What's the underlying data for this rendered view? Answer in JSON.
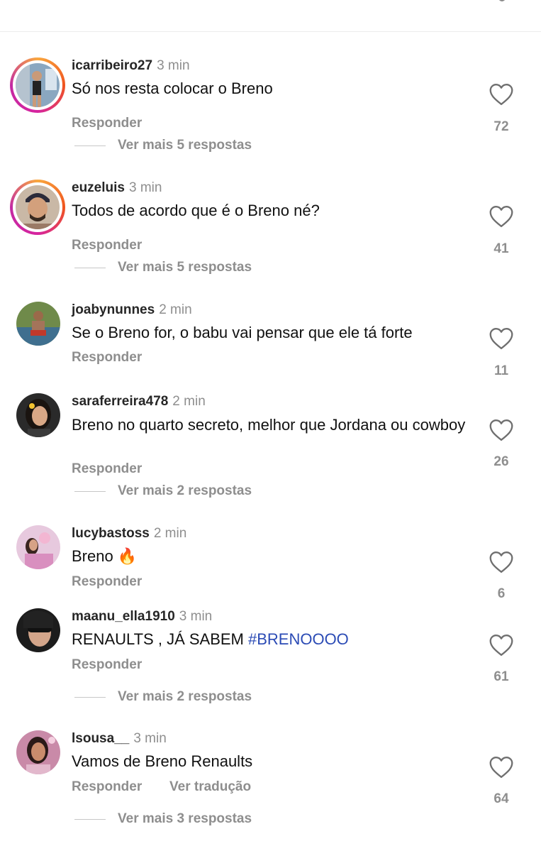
{
  "comments": [
    {
      "username": "icarribeiro27",
      "time": "3 min",
      "text": "Só nos resta colocar o Breno",
      "reply": "Responder",
      "more": "Ver mais 5 respostas",
      "likes": "72",
      "heart_icon": "heart-outline-icon",
      "story_ring": true
    },
    {
      "username": "euzeluis",
      "time": "3 min",
      "text": "Todos de acordo que é o Breno né?",
      "reply": "Responder",
      "more": "Ver mais 5 respostas",
      "likes": "41",
      "heart_icon": "heart-outline-icon",
      "story_ring": true
    },
    {
      "username": "joabynunnes",
      "time": "2 min",
      "text": "Se o Breno for, o babu vai pensar que ele tá forte",
      "reply": "Responder",
      "likes": "11",
      "heart_icon": "heart-outline-icon",
      "story_ring": false
    },
    {
      "username": "saraferreira478",
      "time": "2 min",
      "text": "Breno no quarto secreto,  melhor que Jordana ou cowboy",
      "reply": "Responder",
      "more": "Ver mais 2 respostas",
      "likes": "26",
      "heart_icon": "heart-outline-icon",
      "story_ring": false
    },
    {
      "username": "lucybastoss",
      "time": "2 min",
      "text": "Breno 🔥",
      "reply": "Responder",
      "likes": "6",
      "heart_icon": "heart-outline-icon",
      "story_ring": false
    },
    {
      "username": "maanu_ella1910",
      "time": "3 min",
      "text": "RENAULTS , JÁ SABEM ",
      "hashtag": "#BRENOOOO",
      "reply": "Responder",
      "more": "Ver mais 2 respostas",
      "likes": "61",
      "heart_icon": "heart-outline-icon",
      "story_ring": false
    },
    {
      "username": "lsousa__",
      "time": "3 min",
      "text": "Vamos de Breno Renaults",
      "reply": "Responder",
      "translate": "Ver tradução",
      "more": "Ver mais 3 respostas",
      "likes": "64",
      "heart_icon": "heart-outline-icon",
      "story_ring": false
    }
  ],
  "colors": {
    "hashtag": "#2b4bb5",
    "secondary_text": "#8e8e8e",
    "ring_gradient": [
      "#f9a73e",
      "#f0541e",
      "#d6249f"
    ]
  }
}
